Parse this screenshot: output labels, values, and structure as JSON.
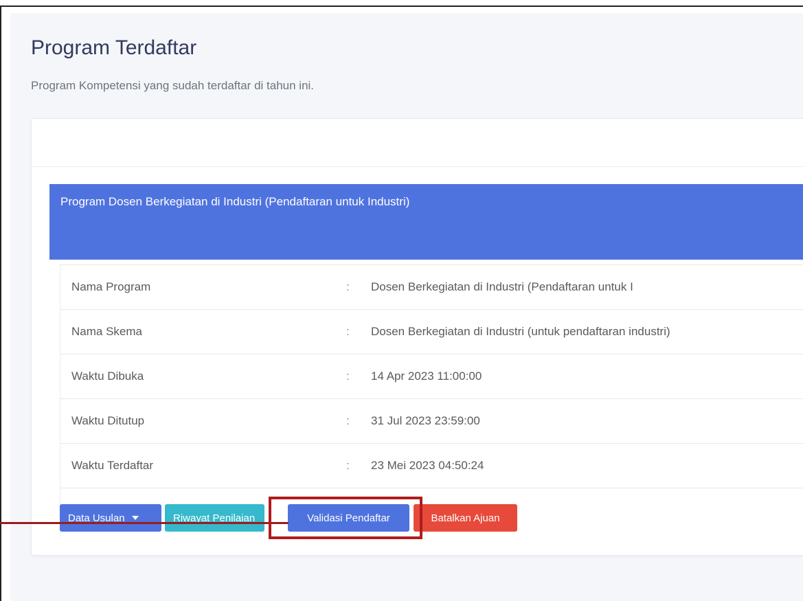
{
  "page": {
    "title": "Program Terdaftar",
    "subtitle": "Program Kompetensi yang sudah terdaftar di tahun ini."
  },
  "program": {
    "title": "Program Dosen Berkegiatan di Industri (Pendaftaran untuk Industri)"
  },
  "details": [
    {
      "label": "Nama Program",
      "separator": ":",
      "value": "Dosen Berkegiatan di Industri (Pendaftaran untuk I"
    },
    {
      "label": "Nama Skema",
      "separator": ":",
      "value": "Dosen Berkegiatan di Industri (untuk pendaftaran industri)"
    },
    {
      "label": "Waktu Dibuka",
      "separator": ":",
      "value": "14 Apr 2023 11:00:00"
    },
    {
      "label": "Waktu Ditutup",
      "separator": ":",
      "value": "31 Jul 2023 23:59:00"
    },
    {
      "label": "Waktu Terdaftar",
      "separator": ":",
      "value": "23 Mei 2023 04:50:24"
    }
  ],
  "actions": {
    "data_usulan": "Data Usulan",
    "riwayat_penilaian": "Riwayat Penilaian",
    "validasi_pendaftar": "Validasi Pendaftar",
    "batalkan_ajuan": "Batalkan Ajuan"
  },
  "colors": {
    "primary": "#4f73de",
    "info": "#36b9cc",
    "danger": "#e74a3b",
    "annotation": "#b01c1c"
  },
  "icons": {
    "dropdown": "caret-down-icon"
  }
}
